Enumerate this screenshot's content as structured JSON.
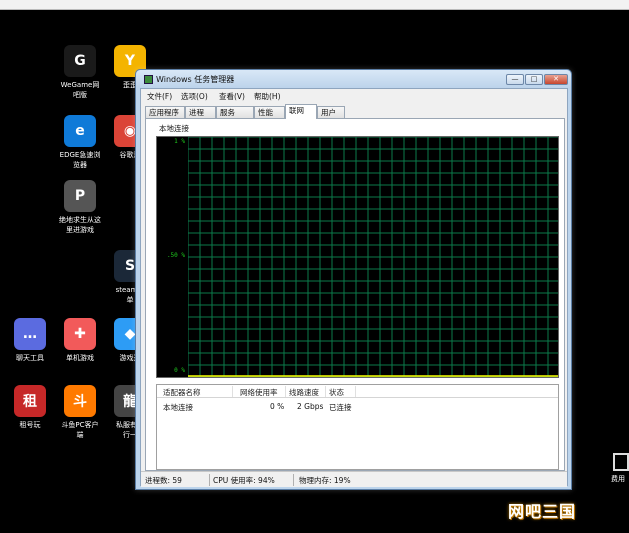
{
  "desktop": {
    "icons": [
      {
        "label": "WeGame网\n吧版",
        "glyph": "G",
        "color": "#1a1a1a"
      },
      {
        "label": "歪歪",
        "glyph": "Y",
        "color": "#f4b400"
      },
      {
        "label": "EDGE急速浏\n览器",
        "glyph": "e",
        "color": "#0f7ad8"
      },
      {
        "label": "谷歌浏",
        "glyph": "◉",
        "color": "#db4437"
      },
      {
        "label": "绝地求生从这\n里进游戏",
        "glyph": "P",
        "color": "#555555"
      },
      {
        "label": "steam游\n单",
        "glyph": "S",
        "color": "#1b2838"
      },
      {
        "label": "聊天工具",
        "glyph": "…",
        "color": "#5b6be0"
      },
      {
        "label": "单机游戏",
        "glyph": "✚",
        "color": "#f25a5a"
      },
      {
        "label": "游戏迅",
        "glyph": "◆",
        "color": "#2d9cf5"
      },
      {
        "label": "租号玩",
        "glyph": "租",
        "color": "#c62828"
      },
      {
        "label": "斗鱼PC客户\n端",
        "glyph": "斗",
        "color": "#ff7a00"
      },
      {
        "label": "私服有问\n行一",
        "glyph": "龍",
        "color": "#444444"
      }
    ],
    "right_icon_label": "费用",
    "watermark": "网吧三国"
  },
  "window": {
    "title": "Windows 任务管理器",
    "buttons": {
      "minimize": "—",
      "maximize": "□",
      "close": "✕"
    },
    "menu": [
      "文件(F)",
      "选项(O)",
      "查看(V)",
      "帮助(H)"
    ],
    "tabs": [
      "应用程序",
      "进程",
      "服务",
      "性能",
      "联网",
      "用户"
    ],
    "active_tab": "联网",
    "connection_title": "本地连接",
    "chart_data": {
      "type": "line",
      "title": "本地连接",
      "ylabel": "",
      "yticks": [
        "1 %",
        ".50 %",
        "0 %"
      ],
      "ylim": [
        0,
        1
      ],
      "grid": true,
      "series": [
        {
          "name": "本地连接",
          "values": [
            0
          ]
        }
      ]
    },
    "table": {
      "headers": [
        "适配器名称",
        "网络使用率",
        "线路速度",
        "状态"
      ],
      "rows": [
        [
          "本地连接",
          "0 %",
          "2 Gbps",
          "已连接"
        ]
      ]
    },
    "status": {
      "processes": "进程数: 59",
      "cpu": "CPU 使用率: 94%",
      "memory": "物理内存: 19%"
    }
  }
}
